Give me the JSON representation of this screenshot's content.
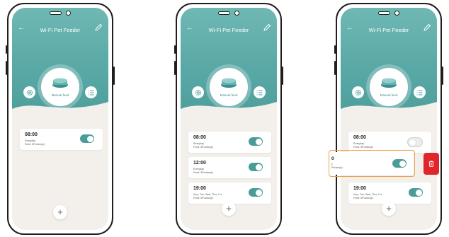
{
  "app": {
    "title": "Wi-Fi Pet Feeder",
    "back_icon": "back-arrow-icon",
    "edit_icon": "pencil-icon",
    "manual_feed_label": "Manual feed",
    "settings_icon": "gear-icon",
    "list_icon": "list-icon",
    "add_label": "+",
    "accent_color": "#5aa9a6",
    "delete_color": "#e0262b",
    "highlight_color": "#f0a04b"
  },
  "screens": [
    {
      "schedules": [
        {
          "time": "08:00",
          "days": "Everyday",
          "portions": "Feed: 5Portion(s)",
          "enabled": true
        }
      ]
    },
    {
      "schedules": [
        {
          "time": "08:00",
          "days": "Everyday",
          "portions": "Feed: 5Portion(s)",
          "enabled": true
        },
        {
          "time": "12:00",
          "days": "Everyday",
          "portions": "Feed: 5Portion(s)",
          "enabled": true
        },
        {
          "time": "19:00",
          "days": "Mon, Tue, Wed, Thur, Fri,",
          "portions": "Feed: 5Portion(s)",
          "enabled": true
        }
      ]
    },
    {
      "schedules": [
        {
          "time": "08:00",
          "days": "Everyday",
          "portions": "Feed: 5Portion(s)",
          "enabled": false
        },
        {
          "time": "0",
          "days": "y",
          "portions": "Portion(s)",
          "enabled": true
        },
        {
          "time": "19:00",
          "days": "Mon, Tue, Wed, Thur, Fri,",
          "portions": "Feed: 5Portion(s)",
          "enabled": true
        }
      ],
      "delete_icon": "trash-icon"
    }
  ]
}
